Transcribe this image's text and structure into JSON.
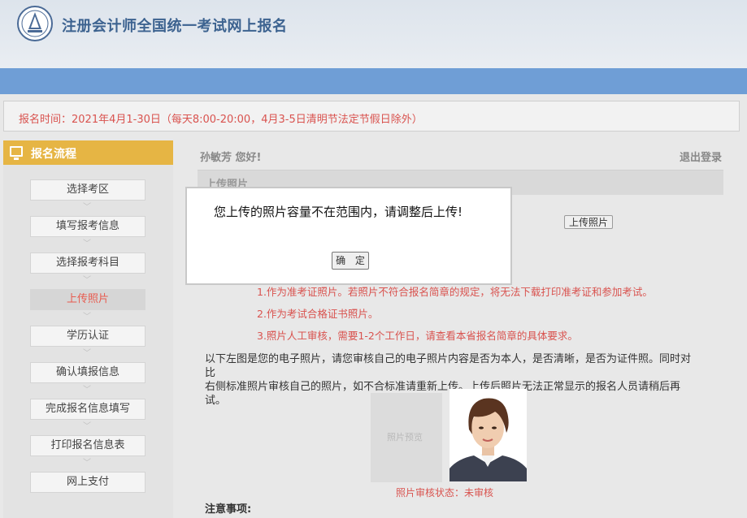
{
  "header": {
    "site_title": "注册会计师全国统一考试网上报名"
  },
  "notice": {
    "text": "报名时间：2021年4月1-30日（每天8:00-20:00，4月3-5日清明节法定节假日除外）"
  },
  "sidebar": {
    "title": "报名流程",
    "steps": [
      {
        "label": "选择考区"
      },
      {
        "label": "填写报考信息"
      },
      {
        "label": "选择报考科目"
      },
      {
        "label": "上传照片"
      },
      {
        "label": "学历认证"
      },
      {
        "label": "确认填报信息"
      },
      {
        "label": "完成报名信息填写"
      },
      {
        "label": "打印报名信息表"
      },
      {
        "label": "网上支付"
      }
    ],
    "active_step": "上传照片"
  },
  "main": {
    "greeting": "孙敏芳 您好!",
    "logout": "退出登录",
    "section_title": "上传照片",
    "upload_button": "上传照片",
    "rules": [
      "1.作为准考证照片。若照片不符合报名简章的规定，将无法下载打印准考证和参加考试。",
      "2.作为考试合格证书照片。",
      "3.照片人工审核，需要1-2个工作日，请查看本省报名简章的具体要求。"
    ],
    "description_line1": "以下左图是您的电子照片，请您审核自己的电子照片内容是否为本人，是否清晰，是否为证件照。同时对比",
    "description_line2": "右侧标准照片审核自己的照片，如不合标准请重新上传。上传后照片无法正常显示的报名人员请稍后再试。",
    "photo_placeholder": "照片预览",
    "audit_status": "照片审核状态：未审核",
    "notes_title": "注意事项:"
  },
  "dialog": {
    "message": "您上传的照片容量不在范围内，请调整后上传!",
    "ok_button": "确 定"
  },
  "colors": {
    "header_blue_bar": "#6f9ed6",
    "sidebar_header": "#e6b544",
    "warning_red": "#d9534f",
    "title_blue": "#3d6390"
  }
}
